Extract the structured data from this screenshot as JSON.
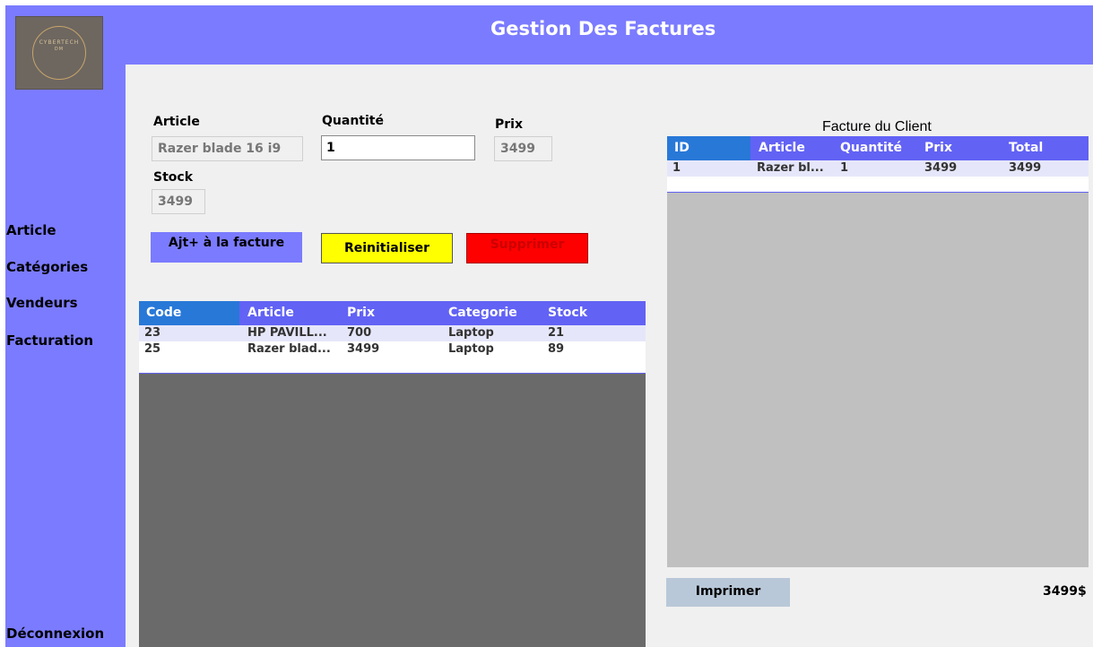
{
  "header": {
    "title": "Gestion Des Factures"
  },
  "logo": {
    "line1": "CYBERTECH",
    "line2": "DM"
  },
  "sidebar": {
    "items": [
      {
        "label": "Article"
      },
      {
        "label": "Catégories"
      },
      {
        "label": "Vendeurs"
      },
      {
        "label": "Facturation"
      }
    ],
    "logout": "Déconnexion"
  },
  "form": {
    "article_label": "Article",
    "article_value": "Razer blade 16 i9",
    "quantity_label": "Quantité",
    "quantity_value": "1",
    "price_label": "Prix",
    "price_value": "3499",
    "stock_label": "Stock",
    "stock_value": "3499"
  },
  "buttons": {
    "add": "Ajt+ à la facture",
    "reset": "Reinitialiser",
    "delete": "Supprimer",
    "print": "Imprimer"
  },
  "articles_table": {
    "columns": [
      "Code",
      "Article",
      "Prix",
      "Categorie",
      "Stock"
    ],
    "rows": [
      [
        "23",
        "HP PAVILL...",
        "700",
        "Laptop",
        "21"
      ],
      [
        "25",
        "Razer blad...",
        "3499",
        "Laptop",
        "89"
      ]
    ]
  },
  "invoice": {
    "title": "Facture du Client",
    "columns": [
      "ID",
      "Article",
      "Quantité",
      "Prix",
      "Total"
    ],
    "rows": [
      [
        "1",
        "Razer bl...",
        "1",
        "3499",
        "3499"
      ]
    ],
    "total": "3499$"
  },
  "colors": {
    "sidebar": "#7b7bff",
    "table_header": "#6262f5",
    "selected_header": "#2878d8",
    "add_button": "#7b7bff",
    "reset_button": "#ffff00",
    "delete_button": "#ff0000",
    "print_button": "#b8c8d8"
  }
}
